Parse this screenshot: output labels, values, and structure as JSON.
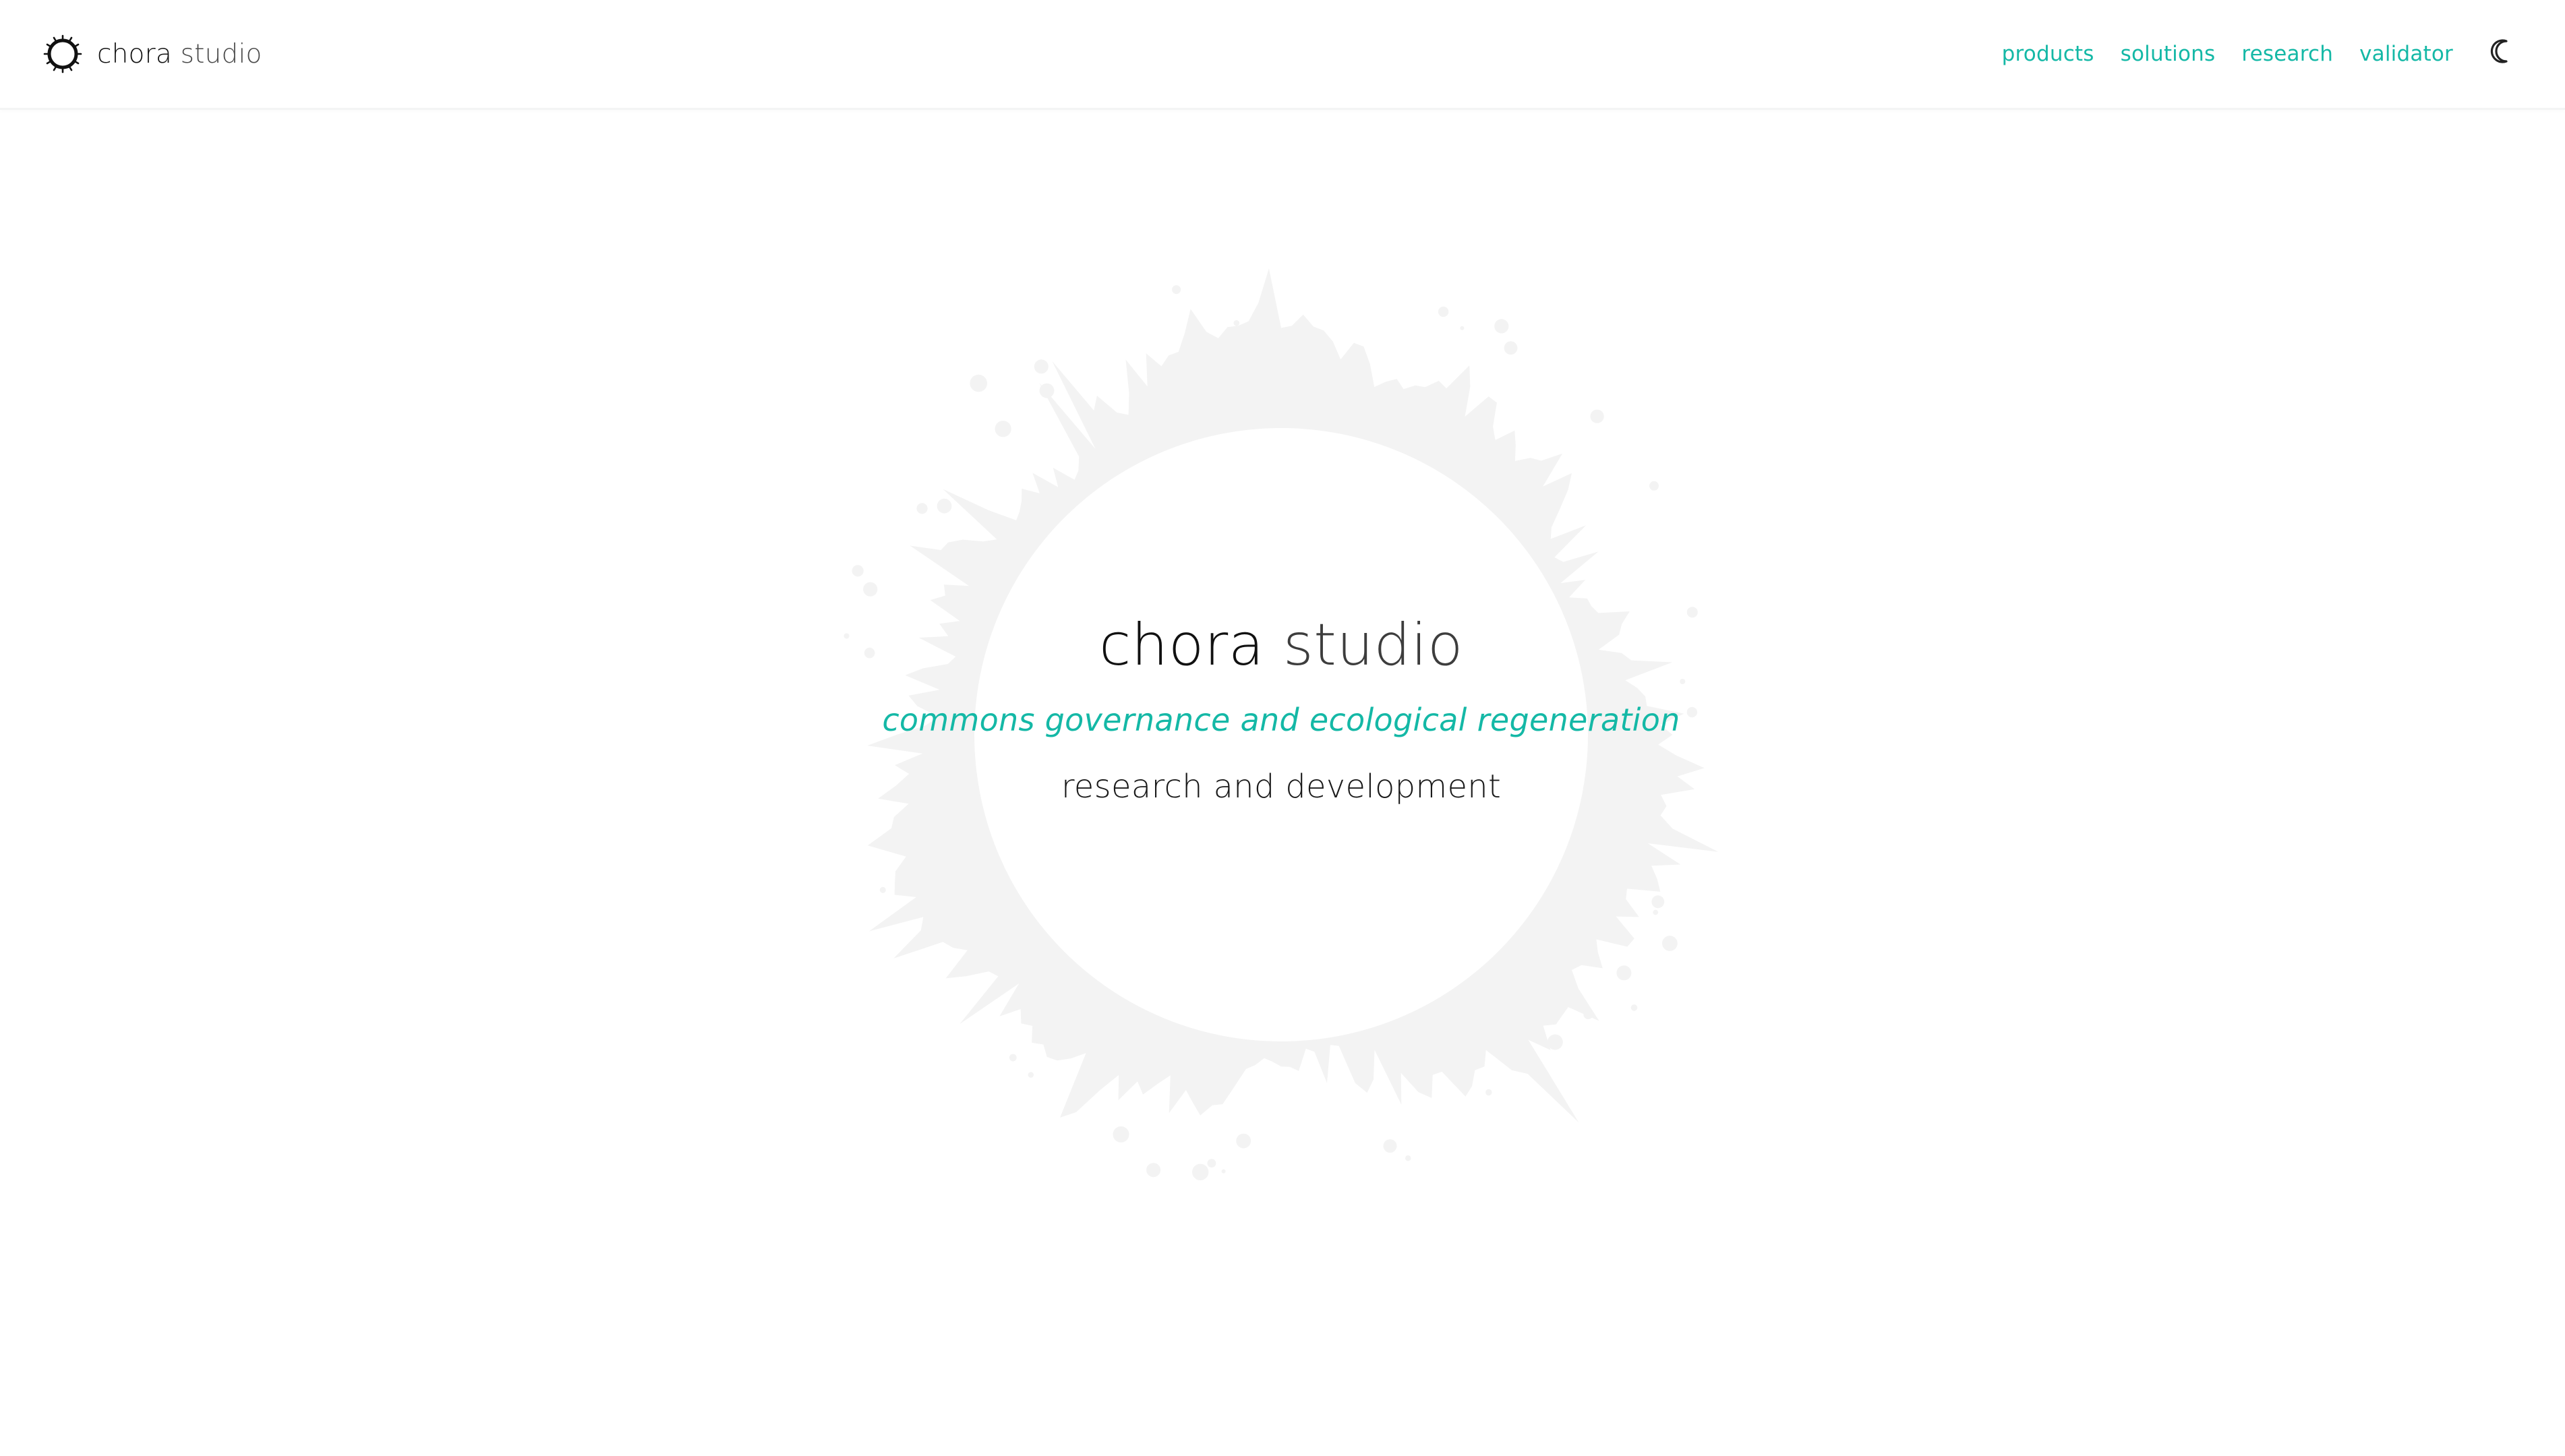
{
  "header": {
    "brand": {
      "name_first": "chora",
      "name_second": "studio",
      "logo_icon": "chora-ring-logo-icon"
    },
    "nav": {
      "items": [
        {
          "label": "products"
        },
        {
          "label": "solutions"
        },
        {
          "label": "research"
        },
        {
          "label": "validator"
        }
      ],
      "theme_toggle_icon": "moon-icon"
    }
  },
  "hero": {
    "title_first": "chora",
    "title_second": "studio",
    "tagline": "commons governance and ecological regeneration",
    "subtitle": "research and development",
    "background_icon": "splash-ring-icon"
  },
  "colors": {
    "accent": "#14b8a6",
    "text": "#111111",
    "muted_text": "#3d3d3d",
    "background": "#ffffff",
    "ring": "#f3f3f3"
  }
}
